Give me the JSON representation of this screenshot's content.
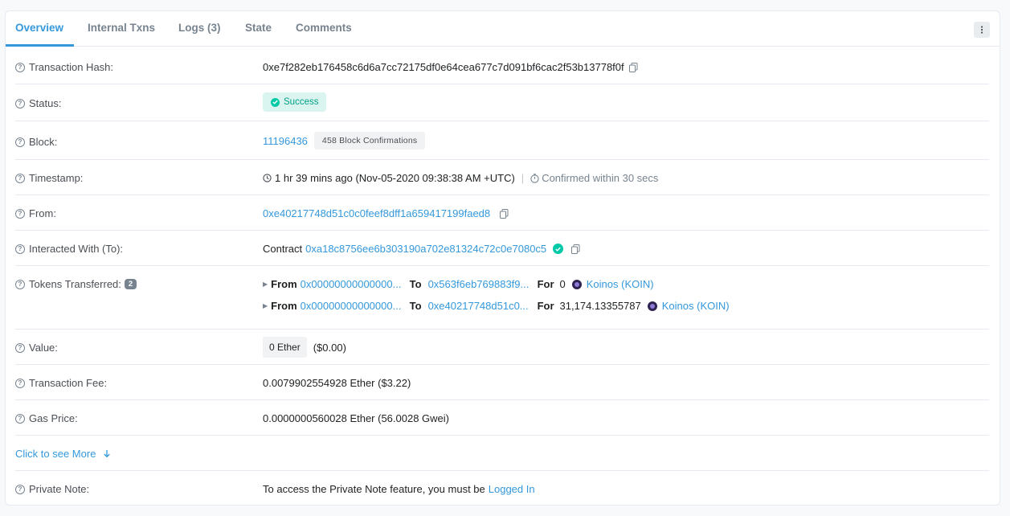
{
  "tabs": [
    {
      "label": "Overview",
      "active": true
    },
    {
      "label": "Internal Txns"
    },
    {
      "label": "Logs (3)"
    },
    {
      "label": "State"
    },
    {
      "label": "Comments"
    }
  ],
  "tx": {
    "hash_label": "Transaction Hash:",
    "hash": "0xe7f282eb176458c6d6a7cc72175df0e64cea677c7d091bf6cac2f53b13778f0f",
    "status_label": "Status:",
    "status": "Success",
    "block_label": "Block:",
    "block": "11196436",
    "confirmations": "458 Block Confirmations",
    "timestamp_label": "Timestamp:",
    "timestamp": "1 hr 39 mins ago (Nov-05-2020 09:38:38 AM +UTC)",
    "confirmed_within": "Confirmed within 30 secs",
    "from_label": "From:",
    "from": "0xe40217748d51c0c0feef8dff1a659417199faed8",
    "to_label": "Interacted With (To):",
    "to_prefix": "Contract",
    "to": "0xa18c8756ee6b303190a702e81324c72c0e7080c5",
    "tokens_label": "Tokens Transferred:",
    "tokens_count": "2",
    "transfers": [
      {
        "from_word": "From",
        "from": "0x00000000000000...",
        "to_word": "To",
        "to": "0x563f6eb769883f9...",
        "for_word": "For",
        "amount": "0",
        "token": "Koinos (KOIN)"
      },
      {
        "from_word": "From",
        "from": "0x00000000000000...",
        "to_word": "To",
        "to": "0xe40217748d51c0...",
        "for_word": "For",
        "amount": "31,174.13355787",
        "token": "Koinos (KOIN)"
      }
    ],
    "value_label": "Value:",
    "value": "0 Ether",
    "value_usd": "($0.00)",
    "fee_label": "Transaction Fee:",
    "fee": "0.0079902554928 Ether ($3.22)",
    "gas_label": "Gas Price:",
    "gas": "0.0000000560028 Ether (56.0028 Gwei)",
    "see_more": "Click to see More",
    "note_label": "Private Note:",
    "note_text": "To access the Private Note feature, you must be",
    "note_link": "Logged In"
  },
  "colors": {
    "accent": "#3498db",
    "success": "#00c9a7",
    "token_icon": "#2e2350"
  },
  "icons": [
    "question-icon",
    "copy-icon",
    "check-circle-icon",
    "clock-icon",
    "timer-icon",
    "caret-right-icon",
    "arrow-down-icon",
    "more-vertical-icon",
    "koinos-token-icon"
  ]
}
